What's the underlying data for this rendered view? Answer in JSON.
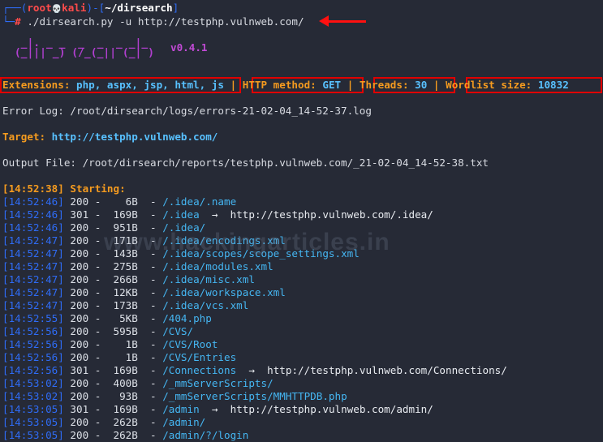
{
  "prompt": {
    "open": "┌──(",
    "user": "root",
    "skull": "💀",
    "host": "kali",
    "close": ")-[",
    "dir": "~/dirsearch",
    "end": "]",
    "corner": "└─",
    "hash": "#",
    "command": " ./dirsearch.py -u http://testphp.vulnweb.com/"
  },
  "logo": {
    "line1": "  _|. _ _  _  _  _ _|_",
    "line2": " (_||| _) (/_(_|| (_| )",
    "version": "v0.4.1"
  },
  "info": {
    "extensions_label": "Extensions:",
    "extensions_value": "php, aspx, jsp, html, js",
    "method_label": "HTTP method:",
    "method_value": "GET",
    "threads_label": "Threads:",
    "threads_value": "30",
    "wordlist_label": "Wordlist size:",
    "wordlist_value": "10832",
    "separator": "|"
  },
  "error_log": "Error Log: /root/dirsearch/logs/errors-21-02-04_14-52-37.log",
  "target_label": "Target:",
  "target_value": "http://testphp.vulnweb.com/",
  "output_file": "Output File: /root/dirsearch/reports/testphp.vulnweb.com/_21-02-04_14-52-38.txt",
  "starting": {
    "time": "[14:52:38]",
    "text": "Starting:"
  },
  "results": [
    {
      "time": "[14:52:46]",
      "status": "200",
      "size": "6B",
      "path": "/.idea/.name",
      "redirect": ""
    },
    {
      "time": "[14:52:46]",
      "status": "301",
      "size": "169B",
      "path": "/.idea",
      "redirect": "http://testphp.vulnweb.com/.idea/"
    },
    {
      "time": "[14:52:46]",
      "status": "200",
      "size": "951B",
      "path": "/.idea/",
      "redirect": ""
    },
    {
      "time": "[14:52:47]",
      "status": "200",
      "size": "171B",
      "path": "/.idea/encodings.xml",
      "redirect": ""
    },
    {
      "time": "[14:52:47]",
      "status": "200",
      "size": "143B",
      "path": "/.idea/scopes/scope_settings.xml",
      "redirect": ""
    },
    {
      "time": "[14:52:47]",
      "status": "200",
      "size": "275B",
      "path": "/.idea/modules.xml",
      "redirect": ""
    },
    {
      "time": "[14:52:47]",
      "status": "200",
      "size": "266B",
      "path": "/.idea/misc.xml",
      "redirect": ""
    },
    {
      "time": "[14:52:47]",
      "status": "200",
      "size": "12KB",
      "path": "/.idea/workspace.xml",
      "redirect": ""
    },
    {
      "time": "[14:52:47]",
      "status": "200",
      "size": "173B",
      "path": "/.idea/vcs.xml",
      "redirect": ""
    },
    {
      "time": "[14:52:55]",
      "status": "200",
      "size": "5KB",
      "path": "/404.php",
      "redirect": ""
    },
    {
      "time": "[14:52:56]",
      "status": "200",
      "size": "595B",
      "path": "/CVS/",
      "redirect": ""
    },
    {
      "time": "[14:52:56]",
      "status": "200",
      "size": "1B",
      "path": "/CVS/Root",
      "redirect": ""
    },
    {
      "time": "[14:52:56]",
      "status": "200",
      "size": "1B",
      "path": "/CVS/Entries",
      "redirect": ""
    },
    {
      "time": "[14:52:56]",
      "status": "301",
      "size": "169B",
      "path": "/Connections",
      "redirect": "http://testphp.vulnweb.com/Connections/"
    },
    {
      "time": "[14:53:02]",
      "status": "200",
      "size": "400B",
      "path": "/_mmServerScripts/",
      "redirect": ""
    },
    {
      "time": "[14:53:02]",
      "status": "200",
      "size": "93B",
      "path": "/_mmServerScripts/MMHTTPDB.php",
      "redirect": ""
    },
    {
      "time": "[14:53:05]",
      "status": "301",
      "size": "169B",
      "path": "/admin",
      "redirect": "http://testphp.vulnweb.com/admin/"
    },
    {
      "time": "[14:53:05]",
      "status": "200",
      "size": "262B",
      "path": "/admin/",
      "redirect": ""
    },
    {
      "time": "[14:53:05]",
      "status": "200",
      "size": "262B",
      "path": "/admin/?/login",
      "redirect": ""
    }
  ],
  "redirect_arrow": "→",
  "watermark": "www.hackingarticles.in",
  "colors": {
    "background": "#262a36",
    "timestamp": "#2f6cf6",
    "path": "#45b6f2",
    "label": "#f59b1f",
    "value": "#58c1ff",
    "highlight_box": "#e00000",
    "logo": "#b13fd0"
  }
}
